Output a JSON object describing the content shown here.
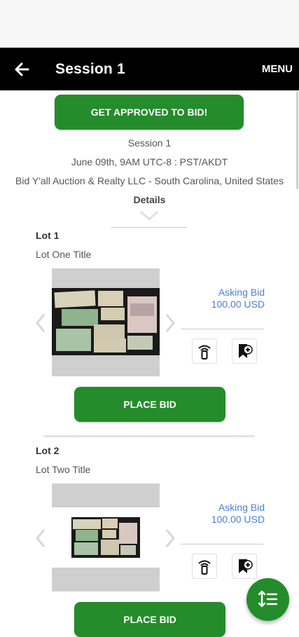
{
  "header": {
    "title": "Session 1",
    "menu_label": "MENU"
  },
  "approve_button": "GET APPROVED TO BID!",
  "session_info": {
    "name": "Session 1",
    "date": "June 09th, 9AM UTC-8 : PST/AKDT",
    "auctioneer": "Bid Y'all Auction & Realty LLC - South Carolina, United States"
  },
  "details_label": "Details",
  "lots": [
    {
      "number": "Lot 1",
      "title": "Lot One Title",
      "asking_label": "Asking Bid",
      "asking_value": "100.00 USD",
      "place_bid": "PLACE BID"
    },
    {
      "number": "Lot 2",
      "title": "Lot Two Title",
      "asking_label": "Asking Bid",
      "asking_value": "100.00 USD",
      "place_bid": "PLACE BID"
    }
  ],
  "colors": {
    "primary_green": "#248c2a",
    "link_blue": "#4a80d6",
    "appbar": "#000000"
  },
  "icons": [
    "back-arrow-icon",
    "paddle-bid-icon",
    "watchlist-add-icon",
    "sort-icon",
    "chevron-left-icon",
    "chevron-right-icon",
    "chevron-down-icon"
  ]
}
